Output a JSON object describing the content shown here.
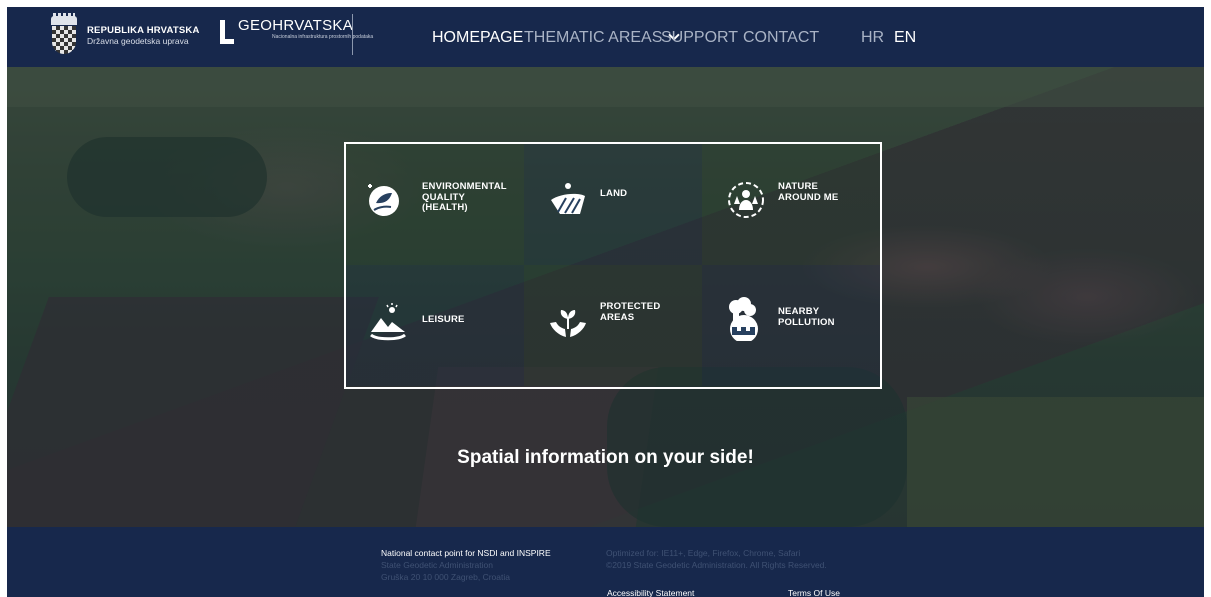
{
  "header": {
    "brand_rh": {
      "line1": "REPUBLIKA HRVATSKA",
      "line2": "Državna geodetska uprava"
    },
    "brand_geo": {
      "name": "GEOHRVATSKA",
      "subtitle": "Nacionalna infrastruktura prostornih podataka"
    },
    "nav": {
      "homepage": "HOMEPAGE",
      "thematic_areas": "THEMATIC AREAS",
      "support": "SUPPORT",
      "contact": "CONTACT",
      "lang_hr": "HR",
      "lang_en": "EN"
    }
  },
  "tiles": [
    {
      "id": "environmental-quality",
      "label": "ENVIRONMENTAL\nQUALITY\n(HEALTH)",
      "icon": "hands-leaf-plus-icon"
    },
    {
      "id": "land",
      "label": "LAND",
      "icon": "field-furrows-icon"
    },
    {
      "id": "nature-around-me",
      "label": "NATURE\nAROUND ME",
      "icon": "person-with-trees-icon"
    },
    {
      "id": "leisure",
      "label": "LEISURE",
      "icon": "mountain-sun-wave-icon"
    },
    {
      "id": "protected-areas",
      "label": "PROTECTED\nAREAS",
      "icon": "hands-protect-plant-icon"
    },
    {
      "id": "nearby-pollution",
      "label": "NEARBY\nPOLLUTION",
      "icon": "factory-smoke-icon"
    }
  ],
  "hero": {
    "tagline": "Spatial information on your side!"
  },
  "footer": {
    "contact_title": "National contact point for NSDI and INSPIRE",
    "org": "State Geodetic Administration",
    "address": "Gruška 20 10 000 Zagreb, Croatia",
    "optimized": "Optimized for: IE11+, Edge, Firefox, Chrome, Safari",
    "copyright": "©2019 State Geodetic Administration. All Rights Reserved.",
    "accessibility": "Accessibility Statement",
    "terms": "Terms Of Use"
  },
  "colors": {
    "navy": "#17284c",
    "white": "#ffffff",
    "muted_text": "#a9b3c5"
  }
}
